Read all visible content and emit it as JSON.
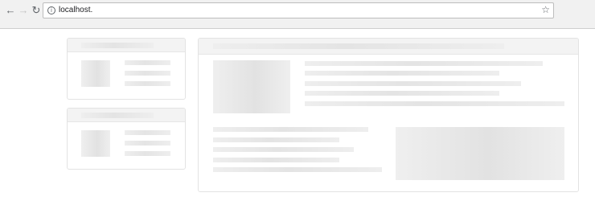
{
  "browser": {
    "url": "localhost.",
    "back_icon": "←",
    "forward_icon": "→",
    "reload_icon": "↻",
    "info_icon": "i",
    "star_icon": "☆"
  }
}
